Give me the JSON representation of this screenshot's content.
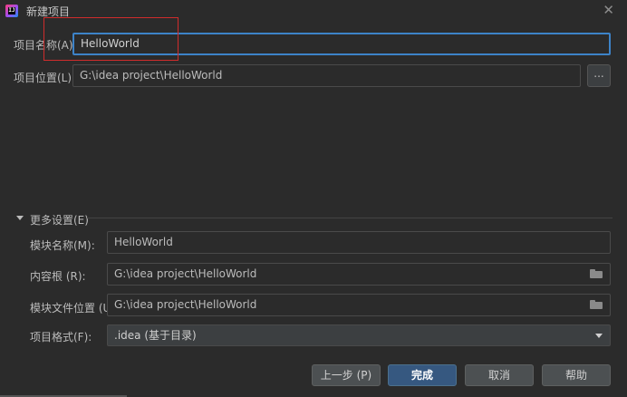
{
  "window": {
    "title": "新建项目",
    "close_glyph": "✕",
    "app_icon": "intellij-idea-icon"
  },
  "project_name": {
    "label": "项目名称(A):",
    "value": "HelloWorld"
  },
  "project_location": {
    "label": "项目位置(L):",
    "value": "G:\\idea project\\HelloWorld",
    "browse_label": "..."
  },
  "more_settings": {
    "label": "更多设置(E)",
    "module_name": {
      "label": "模块名称(M):",
      "value": "HelloWorld"
    },
    "content_root": {
      "label": "内容根 (R):",
      "value": "G:\\idea project\\HelloWorld",
      "icon": "folder-icon"
    },
    "module_file_location": {
      "label": "模块文件位置 (U):",
      "value": "G:\\idea project\\HelloWorld",
      "icon": "folder-icon"
    },
    "project_format": {
      "label": "项目格式(F):",
      "value": ".idea (基于目录)"
    }
  },
  "buttons": {
    "previous": "上一步 (P)",
    "finish": "完成",
    "cancel": "取消",
    "help": "帮助"
  },
  "colors": {
    "background": "#2b2b2b",
    "focus_border": "#3d83c8",
    "primary_button": "#365880",
    "highlight_box": "#d02c2c"
  }
}
